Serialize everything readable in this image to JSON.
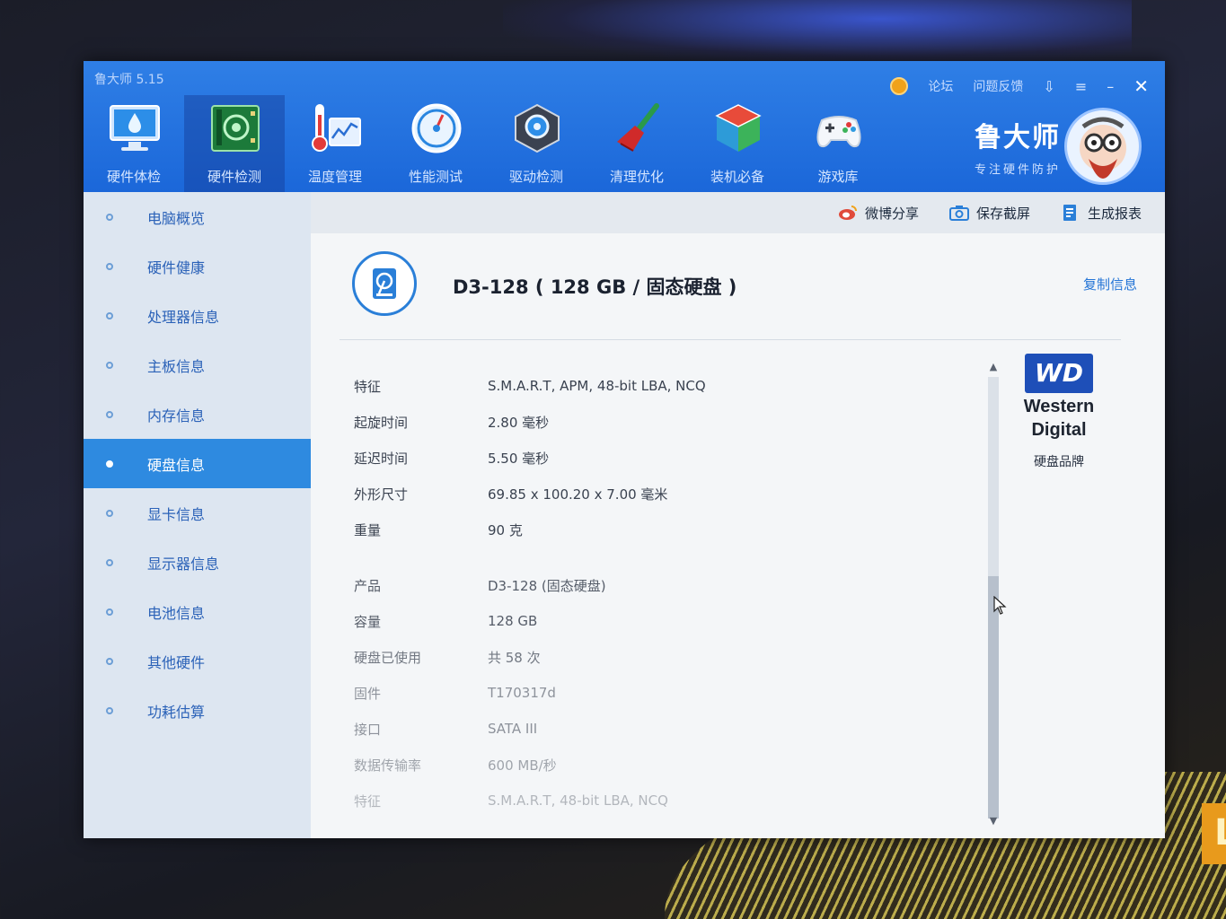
{
  "window": {
    "title": "鲁大师 5.15",
    "top_links": [
      "论坛",
      "问题反馈"
    ]
  },
  "toolbar": {
    "items": [
      {
        "label": "硬件体检",
        "icon": "monitor-drop-icon"
      },
      {
        "label": "硬件检测",
        "icon": "circuit-board-icon",
        "active": true
      },
      {
        "label": "温度管理",
        "icon": "thermometer-chart-icon"
      },
      {
        "label": "性能测试",
        "icon": "speedometer-icon"
      },
      {
        "label": "驱动检测",
        "icon": "gear-chip-icon"
      },
      {
        "label": "清理优化",
        "icon": "broom-icon"
      },
      {
        "label": "装机必备",
        "icon": "cube-icon"
      },
      {
        "label": "游戏库",
        "icon": "gamepad-icon"
      }
    ],
    "brand_name": "鲁大师",
    "brand_slogan": "专注硬件防护"
  },
  "sidebar": {
    "items": [
      {
        "label": "电脑概览"
      },
      {
        "label": "硬件健康"
      },
      {
        "label": "处理器信息"
      },
      {
        "label": "主板信息"
      },
      {
        "label": "内存信息"
      },
      {
        "label": "硬盘信息",
        "active": true
      },
      {
        "label": "显卡信息"
      },
      {
        "label": "显示器信息"
      },
      {
        "label": "电池信息"
      },
      {
        "label": "其他硬件"
      },
      {
        "label": "功耗估算"
      }
    ]
  },
  "actions": {
    "share": "微博分享",
    "screenshot": "保存截屏",
    "report": "生成报表"
  },
  "disk": {
    "title": "D3-128 ( 128 GB / 固态硬盘 )",
    "copy": "复制信息",
    "properties": [
      {
        "key": "特征",
        "value": "S.M.A.R.T,  APM,  48-bit LBA,  NCQ"
      },
      {
        "key": "起旋时间",
        "value": "2.80 毫秒"
      },
      {
        "key": "延迟时间",
        "value": "5.50 毫秒"
      },
      {
        "key": "外形尺寸",
        "value": "69.85 x 100.20 x 7.00 毫米"
      },
      {
        "key": "重量",
        "value": "90 克"
      },
      {
        "key": "产品",
        "value": "D3-128 (固态硬盘)"
      },
      {
        "key": "容量",
        "value": "128 GB"
      },
      {
        "key": "硬盘已使用",
        "value": "共 58 次"
      },
      {
        "key": "固件",
        "value": "T170317d"
      },
      {
        "key": "接口",
        "value": "SATA III"
      },
      {
        "key": "数据传输率",
        "value": "600 MB/秒"
      },
      {
        "key": "特征",
        "value": "S.M.A.R.T,  48-bit LBA,  NCQ"
      }
    ]
  },
  "brand_panel": {
    "logo_mark": "WD",
    "logo_name_1": "Western",
    "logo_name_2": "Digital",
    "caption": "硬盘品牌"
  },
  "colors": {
    "titlebar_blue": "#1b67d9",
    "sidebar_active": "#2e8ae0",
    "link_blue": "#2374d6"
  }
}
